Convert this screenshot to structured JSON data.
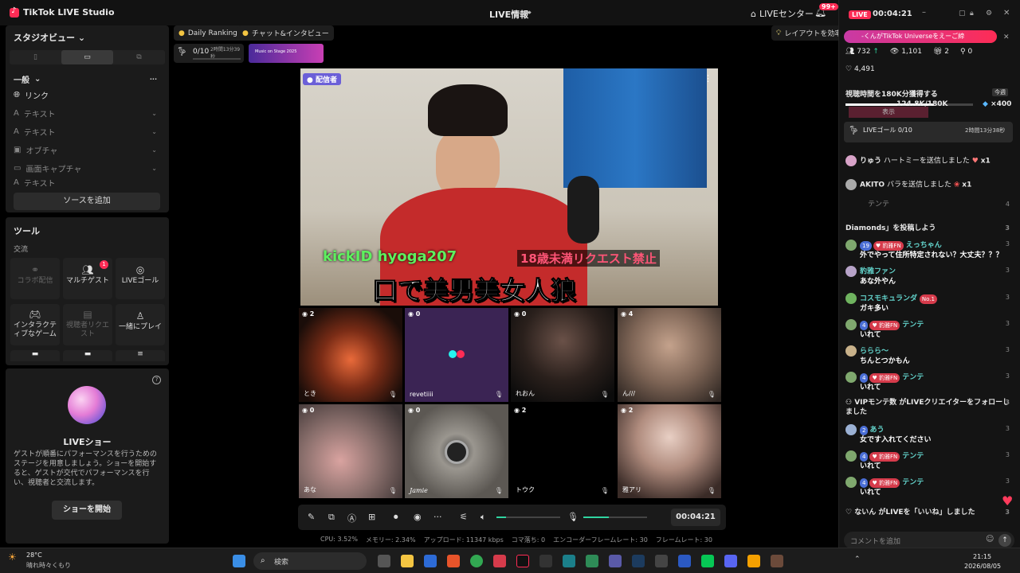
{
  "app": {
    "title": "TikTok LIVE Studio",
    "live_info": "LIVE情報",
    "live_center": "LIVEセンター",
    "notif_badge": "99+"
  },
  "left": {
    "studio_view": "スタジオビュー",
    "general": "一般",
    "link": "リンク",
    "text1": "テキスト",
    "text2": "テキスト",
    "object": "オブチャ",
    "screen_capture": "画面キャプチャ",
    "text3": "テキスト",
    "add_source": "ソースを追加"
  },
  "tools": {
    "title": "ツール",
    "section": "交流",
    "items": [
      {
        "label": "コラボ配信",
        "icon": "link-icon",
        "enabled": false
      },
      {
        "label": "マルチゲスト",
        "icon": "users-icon",
        "enabled": true,
        "badge": "1"
      },
      {
        "label": "LIVEゴール",
        "icon": "target-icon",
        "enabled": true
      },
      {
        "label": "インタラクティブなゲーム",
        "icon": "gamepad-icon",
        "enabled": true
      },
      {
        "label": "視聴者リクエスト",
        "icon": "request-icon",
        "enabled": false
      },
      {
        "label": "一緒にプレイ",
        "icon": "play-together-icon",
        "enabled": true
      }
    ]
  },
  "liveshow": {
    "title": "LIVEショー",
    "desc": "ゲストが順番にパフォーマンスを行うためのステージを用意しましょう。ショーを開始すると、ゲストが交代でパフォーマンスを行い、視聴者と交流します。",
    "button": "ショーを開始"
  },
  "top": {
    "daily_ranking": "Daily Ranking",
    "chat_interact": "チャット&インタビュー",
    "goal": "0/10",
    "goal_time": "2時間13分39秒",
    "banner": "Music on Stage 2025",
    "layout_tip": "レイアウトを効率"
  },
  "stream": {
    "host_tag": "配信者",
    "overlay1": "kickID hyoga207",
    "overlay2": "18歳未満リクエスト禁止",
    "overlay3": "口で美男美女人狼"
  },
  "guests": [
    {
      "name": "とき",
      "count": "2"
    },
    {
      "name": "revetiiii",
      "count": "0"
    },
    {
      "name": "れおん",
      "count": "0"
    },
    {
      "name": "ん///",
      "count": "4"
    },
    {
      "name": "あな",
      "count": "0"
    },
    {
      "name": "Jamie",
      "count": "0"
    },
    {
      "name": "トウク",
      "count": "2"
    },
    {
      "name": "雅アリ",
      "count": "2"
    }
  ],
  "controls": {
    "timer": "00:04:21"
  },
  "stats": {
    "cpu": "CPU: 3.52%",
    "memory": "メモリー: 2.34%",
    "upload": "アップロード: 11347 kbps",
    "dropped": "コマ落ち: 0",
    "encoder": "エンコーダーフレームレート: 30",
    "framerate": "フレームレート: 30"
  },
  "right": {
    "live_tag": "LIVE",
    "timer": "00:04:21",
    "banner": "-くんがTikTok Universeをえーご締",
    "viewers": "732",
    "views": "1,101",
    "gifts": "2",
    "shares": "0",
    "likes": "4,491",
    "goal_title": "視聴時間を180K分獲得する",
    "goal_tag": "今週",
    "goal_progress": "124.8K/180K",
    "goal_reward": "×400",
    "show_btn": "表示",
    "live_goal": "LIVEゴール 0/10",
    "live_goal_time": "2時間13分38秒",
    "comment_placeholder": "コメントを追加"
  },
  "chat": [
    {
      "user": "りゅう",
      "text": "ハートミーを送信しました",
      "mult": "x1"
    },
    {
      "user": "AKITO",
      "text": "バラを送信しました",
      "mult": "x1"
    },
    {
      "user": "テンテ",
      "text": ""
    },
    {
      "user": "",
      "text": "Diamonds」を投稿しよう"
    },
    {
      "user": "えっちゃん",
      "level": "19",
      "text": "外でやって住所特定されない？大丈夫？？？"
    },
    {
      "user": "豹雅ファン",
      "text": "あな外やん"
    },
    {
      "user": "コスモキュランダ",
      "text": "ガキ多い"
    },
    {
      "user": "テンテ",
      "level": "4",
      "text": "いれて"
    },
    {
      "user": "ららら～",
      "text": "ちんとつかもん"
    },
    {
      "user": "テンテ",
      "level": "4",
      "text": "いれて"
    },
    {
      "user": "VIPモンテ数",
      "text": "がLIVEクリエイターをフォローしました"
    },
    {
      "user": "あう",
      "level": "2",
      "text": "女です入れてください"
    },
    {
      "user": "テンテ",
      "level": "4",
      "text": "いれて"
    },
    {
      "user": "テンテ",
      "level": "4",
      "text": "いれて"
    },
    {
      "user": "ないん",
      "text": "がLIVEを「いいね」しました"
    }
  ],
  "taskbar": {
    "weather_temp": "28°C",
    "weather_desc": "晴れ時々くもり",
    "search": "検索",
    "time": "21:15",
    "date": "2026/08/05"
  }
}
